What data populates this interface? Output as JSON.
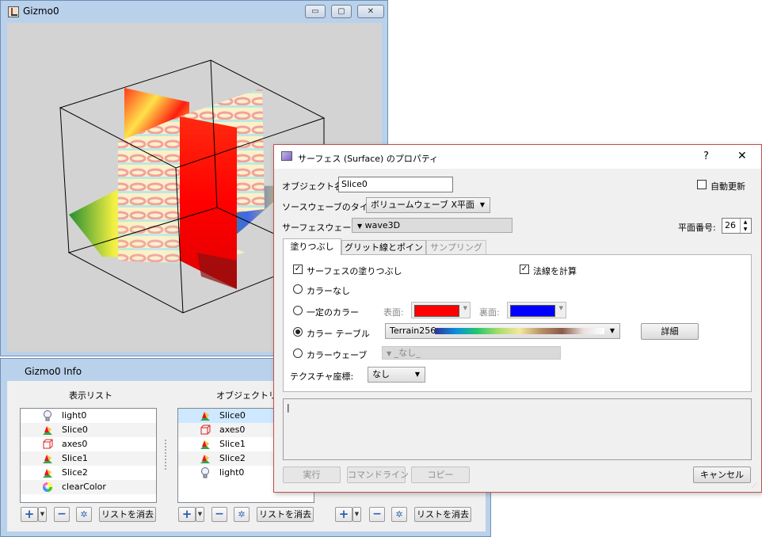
{
  "gizmo_window": {
    "title": "Gizmo0",
    "controls": {
      "minimize": "▭",
      "maximize": "▢",
      "close": "✕"
    }
  },
  "info_window": {
    "title": "Gizmo0 Info",
    "display_list": {
      "header": "表示リスト",
      "items": [
        {
          "label": "light0",
          "icon": "lightbulb-icon"
        },
        {
          "label": "Slice0",
          "icon": "surface-icon"
        },
        {
          "label": "axes0",
          "icon": "axes-icon"
        },
        {
          "label": "Slice1",
          "icon": "surface-icon"
        },
        {
          "label": "Slice2",
          "icon": "surface-icon"
        },
        {
          "label": "clearColor",
          "icon": "color-wheel-icon"
        }
      ]
    },
    "object_list": {
      "header": "オブジェクトリスト",
      "items": [
        {
          "label": "Slice0",
          "icon": "surface-icon"
        },
        {
          "label": "axes0",
          "icon": "axes-icon"
        },
        {
          "label": "Slice1",
          "icon": "surface-icon"
        },
        {
          "label": "Slice2",
          "icon": "surface-icon"
        },
        {
          "label": "light0",
          "icon": "lightbulb-icon"
        }
      ]
    },
    "toolbar": {
      "add": "+",
      "remove": "−",
      "clear_list": "リストを消去"
    }
  },
  "dialog": {
    "title": "サーフェス (Surface) のプロパティ",
    "help": "?",
    "close": "✕",
    "object_name_label": "オブジェクト名:",
    "object_name_value": "Slice0",
    "auto_update_label": "自動更新",
    "auto_update_checked": false,
    "source_type_label": "ソースウェーブのタイプ:",
    "source_type_value": "ボリュームウェーブ X平面",
    "surface_wave_label": "サーフェスウェーブ:",
    "surface_wave_value": "wave3D",
    "plane_number_label": "平面番号:",
    "plane_number_value": "26",
    "tabs": [
      {
        "label": "塗りつぶし",
        "state": "active"
      },
      {
        "label": "グリット線とポイント",
        "state": "normal"
      },
      {
        "label": "サンプリング",
        "state": "disabled"
      }
    ],
    "fill_surface_label": "サーフェスの塗りつぶし",
    "fill_surface_checked": true,
    "compute_normals_label": "法線を計算",
    "compute_normals_checked": true,
    "no_color_label": "カラーなし",
    "constant_color_label": "一定のカラー",
    "front_label": "表面:",
    "back_label": "裏面:",
    "front_color": "#ff0000",
    "back_color": "#0000ff",
    "color_table_label": "カラー テーブル",
    "color_table_value": "Terrain256",
    "details_label": "詳細",
    "color_wave_label": "カラーウェーブ",
    "color_wave_value": "_なし_",
    "selected_color_mode": "color_table",
    "texture_label": "テクスチャ座標:",
    "texture_value": "なし",
    "command_text": "|",
    "buttons": {
      "execute": "実行",
      "command_line": "コマンドライン",
      "copy": "コピー",
      "cancel": "キャンセル"
    }
  }
}
